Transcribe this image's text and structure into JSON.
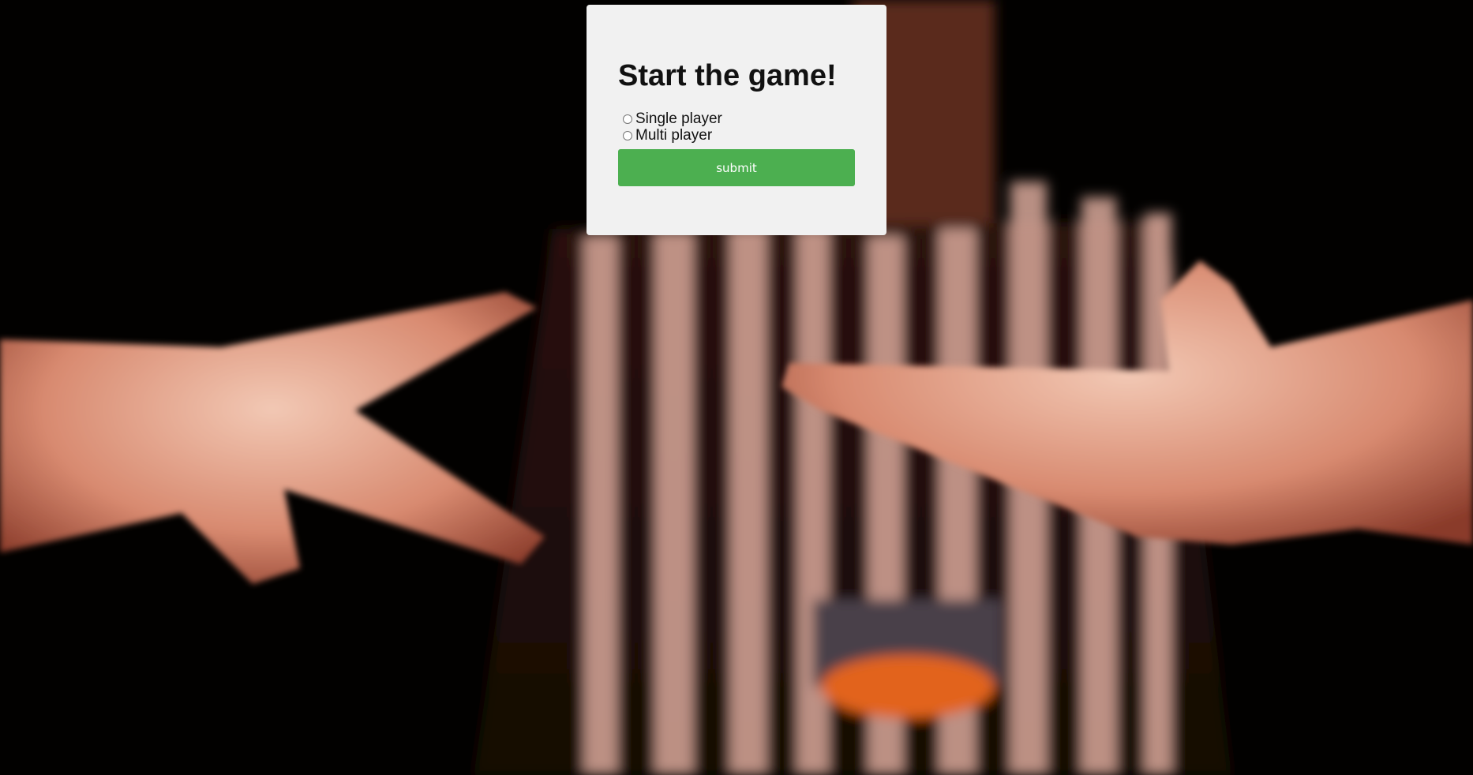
{
  "form": {
    "title": "Start the game!",
    "mode_options": [
      {
        "label": "Single player",
        "value": "single",
        "checked": false
      },
      {
        "label": "Multi player",
        "value": "multi",
        "checked": false
      }
    ],
    "submit_label": "submit"
  },
  "colors": {
    "panel_background": "#f1f1f1",
    "submit_button": "#4caf50",
    "submit_text": "#ffffff",
    "title_text": "#111111"
  }
}
